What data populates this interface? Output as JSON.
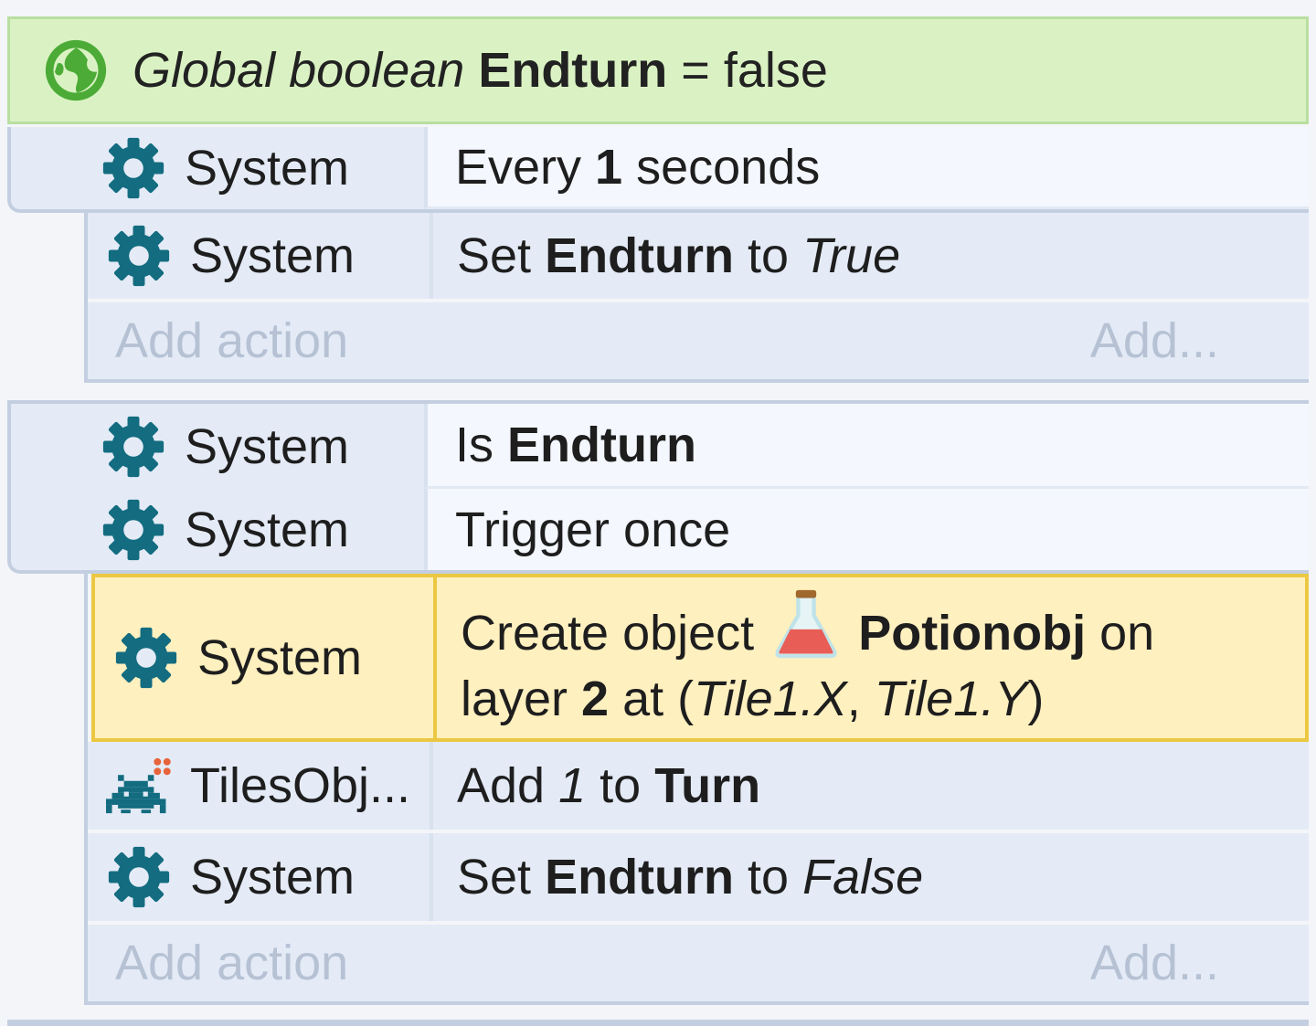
{
  "global_var": {
    "prefix": "Global boolean",
    "name": "Endturn",
    "suffix": "= false",
    "icon": "globe-icon"
  },
  "events": [
    {
      "conditions": [
        {
          "object": "System",
          "icon": "gear-icon",
          "pre": "Every ",
          "bold": "1",
          "post": " seconds"
        }
      ],
      "actions": [
        {
          "object": "System",
          "icon": "gear-icon",
          "pre": "Set ",
          "bold": "Endturn",
          "mid": " to ",
          "italic": "True"
        }
      ],
      "add_action": {
        "label": "Add action",
        "more": "Add..."
      }
    },
    {
      "conditions": [
        {
          "object": "System",
          "icon": "gear-icon",
          "pre": "Is ",
          "bold": "Endturn"
        },
        {
          "object": "System",
          "icon": "gear-icon",
          "text": "Trigger once"
        }
      ],
      "actions": [
        {
          "object": "System",
          "icon": "gear-icon",
          "selected": true,
          "t1": "Create object",
          "obj_icon": "potion-flask-icon",
          "obj_name": "Potionobj",
          "t2": " on",
          "t3": "layer ",
          "layer": "2",
          "t4": " at (",
          "x": "Tile1.X",
          "t5": ", ",
          "y": "Tile1.Y",
          "t6": ")"
        },
        {
          "object": "TilesObj...",
          "icon": "space-invader-icon",
          "pre": "Add ",
          "italic": "1",
          "mid": " to ",
          "bold": "Turn"
        },
        {
          "object": "System",
          "icon": "gear-icon",
          "pre": "Set ",
          "bold": "Endturn",
          "mid": " to ",
          "italic": "False"
        }
      ],
      "add_action": {
        "label": "Add action",
        "more": "Add..."
      }
    }
  ],
  "colors": {
    "global_bg": "#daf2c3",
    "condition_bg": "#e4ebf6",
    "selected_bg": "#fff0bf",
    "selected_border": "#ecc842",
    "gear": "#136c80"
  }
}
